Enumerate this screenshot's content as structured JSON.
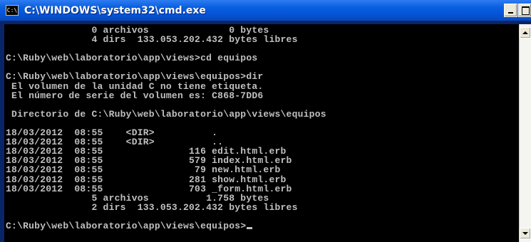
{
  "window": {
    "title": "C:\\WINDOWS\\system32\\cmd.exe",
    "icon": "cmd-icon",
    "icon_glyph": "C:\\",
    "controls": {
      "minimize": "minimize-icon",
      "maximize": "maximize-icon",
      "close": "close-icon",
      "close_glyph": "×"
    }
  },
  "console": {
    "colors": {
      "background": "#000000",
      "foreground": "#c0c0c0"
    },
    "lines": [
      "               0 archivos              0 bytes",
      "               4 dirs  133.053.202.432 bytes libres",
      "",
      "C:\\Ruby\\web\\laboratorio\\app\\views>cd equipos",
      "",
      "C:\\Ruby\\web\\laboratorio\\app\\views\\equipos>dir",
      " El volumen de la unidad C no tiene etiqueta.",
      " El número de serie del volumen es: C868-7DD6",
      "",
      " Directorio de C:\\Ruby\\web\\laboratorio\\app\\views\\equipos",
      "",
      "18/03/2012  08:55    <DIR>          .",
      "18/03/2012  08:55    <DIR>          ..",
      "18/03/2012  08:55               116 edit.html.erb",
      "18/03/2012  08:55               579 index.html.erb",
      "18/03/2012  08:55                79 new.html.erb",
      "18/03/2012  08:55               281 show.html.erb",
      "18/03/2012  08:55               703 _form.html.erb",
      "               5 archivos          1.758 bytes",
      "               2 dirs  133.053.202.432 bytes libres",
      "",
      "C:\\Ruby\\web\\laboratorio\\app\\views\\equipos>"
    ]
  },
  "scrollbar": {
    "up_icon": "scroll-up-arrow-icon",
    "down_icon": "scroll-down-arrow-icon"
  }
}
